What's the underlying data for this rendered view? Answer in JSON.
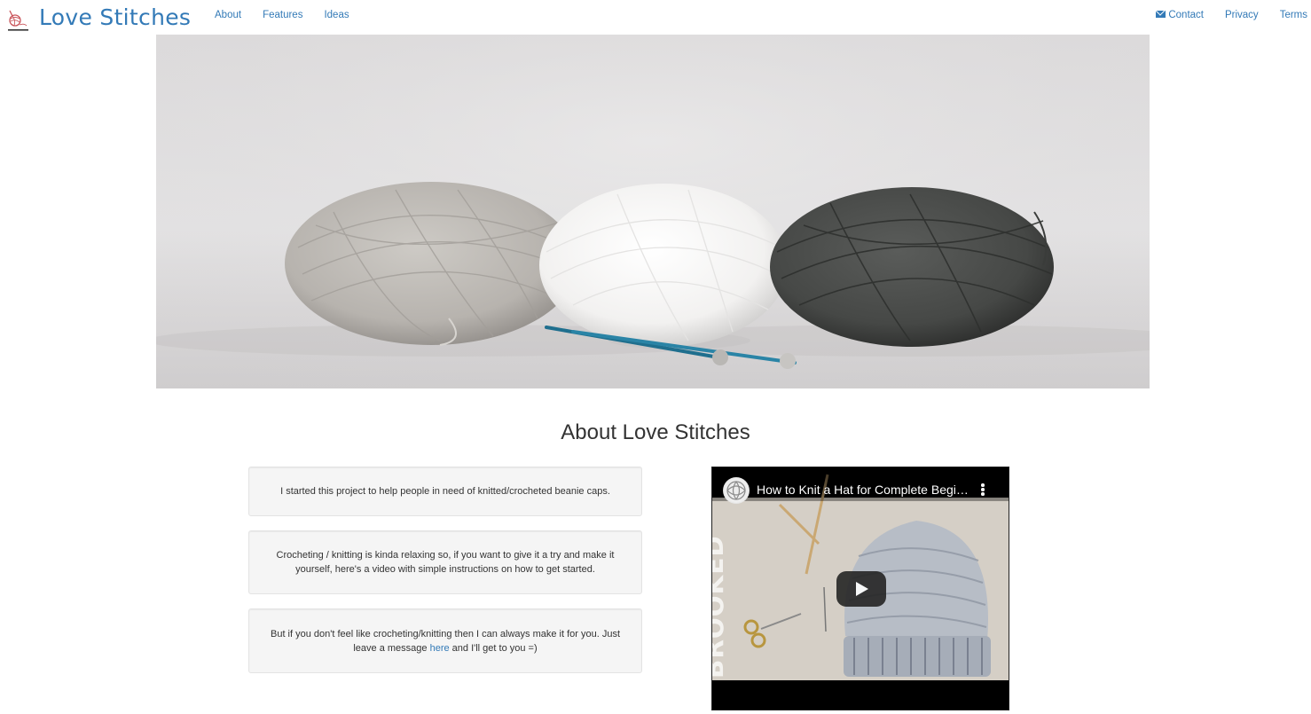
{
  "navbar": {
    "brand": "Love Stitches",
    "left_links": [
      {
        "label": "About"
      },
      {
        "label": "Features"
      },
      {
        "label": "Ideas"
      }
    ],
    "right_links": [
      {
        "label": "Contact",
        "icon": "envelope-icon"
      },
      {
        "label": "Privacy"
      },
      {
        "label": "Terms"
      }
    ],
    "link_color": "#337ab7"
  },
  "hero": {
    "image": "three-yarn-balls-with-knitting-needles"
  },
  "about": {
    "title": "About Love Stitches",
    "paragraph_1": "I started this project to help people in need of knitted/crocheted beanie caps.",
    "paragraph_2": "Crocheting / knitting is kinda relaxing so, if you want to give it a try and make it yourself, here's a video with simple instructions on how to get started.",
    "paragraph_3_before": "But if you don't feel like crocheting/knitting then I can always make it for you. Just leave a message ",
    "paragraph_3_link": "here",
    "paragraph_3_after": " and I'll get to you =)"
  },
  "video": {
    "title": "How to Knit a Hat for Complete Beginners",
    "channel_watermark": "BROOKED",
    "play_icon": "play-icon",
    "menu_icon": "kebab-menu-icon"
  }
}
